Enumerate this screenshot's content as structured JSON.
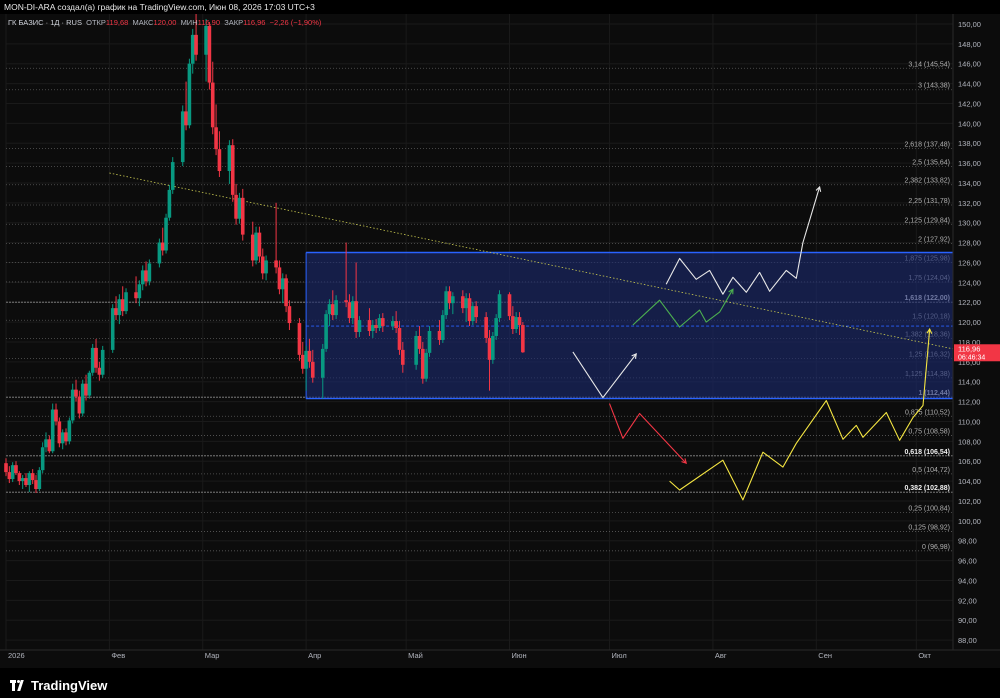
{
  "header": {
    "attribution": "MON-DI-ARA создал(а) график на TradingView.com, Июн 08, 2026 17:03 UTC+3"
  },
  "legend": {
    "symbol": "ГК БАЗИС · 1Д · RUS",
    "open_label": "ОТКР",
    "open": "119,68",
    "high_label": "МАКС",
    "high": "120,00",
    "low_label": "МИН",
    "low": "116,90",
    "close_label": "ЗАКР",
    "close": "116,96",
    "change": "−2,26 (−1,90%)"
  },
  "price_badge": {
    "price": "116,96",
    "countdown": "06:46:34",
    "color": "#f23645"
  },
  "brand": {
    "name": "TradingView"
  },
  "colors": {
    "up": "#089981",
    "down": "#f23645",
    "box_fill": "#1c2a6e",
    "box_border": "#2962ff",
    "path_white": "#e8e8e8",
    "path_green": "#4caf50",
    "path_red": "#f23645",
    "path_yellow": "#f5e642",
    "trendline": "#c8c850"
  },
  "chart_data": {
    "type": "candlestick",
    "y_axis": {
      "range": [
        87,
        151
      ],
      "ticks": [
        "150,00",
        "148,00",
        "146,00",
        "144,00",
        "142,00",
        "140,00",
        "138,00",
        "136,00",
        "134,00",
        "132,00",
        "130,00",
        "128,00",
        "126,00",
        "124,00",
        "122,00",
        "120,00",
        "118,00",
        "116,00",
        "114,00",
        "112,00",
        "110,00",
        "108,00",
        "106,00",
        "104,00",
        "102,00",
        "100,00",
        "98,00",
        "96,00",
        "94,00",
        "92,00",
        "90,00",
        "88,00"
      ]
    },
    "x_axis": {
      "range": [
        "2026-01-01",
        "2026-10-12"
      ],
      "ticks": [
        {
          "date": "2026-01-01",
          "label": "2026"
        },
        {
          "date": "2026-02-01",
          "label": "Фев"
        },
        {
          "date": "2026-03-01",
          "label": "Мар"
        },
        {
          "date": "2026-04-01",
          "label": "Апр"
        },
        {
          "date": "2026-05-01",
          "label": "Май"
        },
        {
          "date": "2026-06-01",
          "label": "Июн"
        },
        {
          "date": "2026-07-01",
          "label": "Июл"
        },
        {
          "date": "2026-08-01",
          "label": "Авг"
        },
        {
          "date": "2026-09-01",
          "label": "Сен"
        },
        {
          "date": "2026-10-01",
          "label": "Окт"
        }
      ]
    },
    "candles_ohlc": [
      [
        "2026-01-01",
        105.8,
        106.3,
        104.5,
        104.9
      ],
      [
        "2026-01-02",
        104.9,
        105.5,
        103.8,
        104.2
      ],
      [
        "2026-01-03",
        104.2,
        105.9,
        103.9,
        105.6
      ],
      [
        "2026-01-04",
        105.6,
        106.0,
        104.6,
        104.8
      ],
      [
        "2026-01-05",
        104.8,
        105.0,
        103.6,
        104.0
      ],
      [
        "2026-01-06",
        104.0,
        104.6,
        103.2,
        104.3
      ],
      [
        "2026-01-07",
        104.3,
        104.8,
        103.4,
        103.6
      ],
      [
        "2026-01-08",
        103.6,
        105.0,
        102.9,
        104.8
      ],
      [
        "2026-01-09",
        104.8,
        105.2,
        103.7,
        104.1
      ],
      [
        "2026-01-10",
        104.1,
        104.6,
        102.8,
        103.2
      ],
      [
        "2026-01-11",
        103.2,
        105.4,
        103.0,
        105.1
      ],
      [
        "2026-01-12",
        105.1,
        107.9,
        104.8,
        107.4
      ],
      [
        "2026-01-13",
        107.4,
        108.9,
        106.9,
        108.2
      ],
      [
        "2026-01-14",
        108.2,
        108.6,
        106.8,
        107.0
      ],
      [
        "2026-01-15",
        107.0,
        111.8,
        106.8,
        111.2
      ],
      [
        "2026-01-16",
        111.2,
        111.8,
        109.6,
        110.0
      ],
      [
        "2026-01-17",
        110.0,
        110.4,
        107.4,
        107.8
      ],
      [
        "2026-01-18",
        107.8,
        109.2,
        107.2,
        108.9
      ],
      [
        "2026-01-19",
        108.9,
        109.3,
        107.6,
        108.0
      ],
      [
        "2026-01-20",
        108.0,
        110.4,
        107.7,
        110.1
      ],
      [
        "2026-01-21",
        110.1,
        113.8,
        109.8,
        113.2
      ],
      [
        "2026-01-22",
        113.2,
        114.2,
        112.0,
        112.5
      ],
      [
        "2026-01-23",
        112.5,
        113.1,
        110.3,
        110.8
      ],
      [
        "2026-01-24",
        110.8,
        114.2,
        110.5,
        113.8
      ],
      [
        "2026-01-25",
        113.8,
        114.7,
        112.1,
        112.6
      ],
      [
        "2026-01-26",
        112.6,
        115.1,
        112.3,
        114.9
      ],
      [
        "2026-01-27",
        114.9,
        117.8,
        114.6,
        117.4
      ],
      [
        "2026-01-28",
        117.4,
        118.3,
        114.9,
        115.4
      ],
      [
        "2026-01-29",
        115.4,
        116.0,
        114.1,
        114.7
      ],
      [
        "2026-01-30",
        114.7,
        117.6,
        114.4,
        117.2
      ],
      [
        "2026-02-02",
        117.2,
        121.8,
        116.9,
        121.4
      ],
      [
        "2026-02-03",
        121.4,
        122.6,
        120.2,
        120.7
      ],
      [
        "2026-02-04",
        120.7,
        122.8,
        119.8,
        122.3
      ],
      [
        "2026-02-05",
        122.3,
        123.6,
        120.6,
        121.1
      ],
      [
        "2026-02-06",
        121.1,
        123.4,
        120.8,
        123.0
      ],
      [
        "2026-02-09",
        123.0,
        124.6,
        121.9,
        122.4
      ],
      [
        "2026-02-10",
        122.4,
        124.2,
        121.6,
        123.8
      ],
      [
        "2026-02-11",
        123.8,
        125.7,
        123.2,
        125.2
      ],
      [
        "2026-02-12",
        125.2,
        126.1,
        123.6,
        124.1
      ],
      [
        "2026-02-13",
        124.1,
        126.3,
        123.7,
        125.9
      ],
      [
        "2026-02-16",
        125.9,
        128.4,
        125.5,
        128.0
      ],
      [
        "2026-02-17",
        128.0,
        129.5,
        126.7,
        127.2
      ],
      [
        "2026-02-18",
        127.2,
        130.9,
        126.9,
        130.5
      ],
      [
        "2026-02-19",
        130.5,
        133.8,
        130.2,
        133.3
      ],
      [
        "2026-02-20",
        133.3,
        136.6,
        132.9,
        136.1
      ],
      [
        "2026-02-23",
        136.1,
        141.8,
        135.7,
        141.2
      ],
      [
        "2026-02-24",
        141.2,
        144.2,
        139.3,
        139.8
      ],
      [
        "2026-02-25",
        139.8,
        146.5,
        139.5,
        146.0
      ],
      [
        "2026-02-26",
        146.0,
        149.5,
        145.0,
        148.9
      ],
      [
        "2026-02-27",
        148.9,
        151.0,
        146.3,
        146.9
      ],
      [
        "2026-03-02",
        146.9,
        150.5,
        144.2,
        149.8
      ],
      [
        "2026-03-03",
        149.8,
        150.2,
        143.4,
        144.1
      ],
      [
        "2026-03-04",
        144.1,
        146.2,
        138.9,
        139.6
      ],
      [
        "2026-03-05",
        139.6,
        141.9,
        136.8,
        137.4
      ],
      [
        "2026-03-06",
        137.4,
        139.2,
        134.6,
        135.2
      ],
      [
        "2026-03-09",
        135.2,
        138.3,
        133.9,
        137.8
      ],
      [
        "2026-03-10",
        137.8,
        138.4,
        132.1,
        132.8
      ],
      [
        "2026-03-11",
        132.8,
        133.9,
        129.8,
        130.4
      ],
      [
        "2026-03-12",
        130.4,
        133.0,
        129.9,
        132.5
      ],
      [
        "2026-03-13",
        132.5,
        133.4,
        128.2,
        128.8
      ],
      [
        "2026-03-16",
        128.8,
        130.1,
        125.6,
        126.2
      ],
      [
        "2026-03-17",
        126.2,
        129.6,
        125.8,
        129.0
      ],
      [
        "2026-03-18",
        129.0,
        129.6,
        126.0,
        126.6
      ],
      [
        "2026-03-19",
        126.6,
        127.4,
        124.3,
        124.9
      ],
      [
        "2026-03-20",
        124.9,
        126.7,
        124.2,
        126.2
      ],
      [
        "2026-03-23",
        126.2,
        132.0,
        124.9,
        125.5
      ],
      [
        "2026-03-24",
        125.5,
        126.2,
        122.8,
        123.3
      ],
      [
        "2026-03-25",
        123.3,
        124.9,
        121.9,
        124.4
      ],
      [
        "2026-03-26",
        124.4,
        124.8,
        121.0,
        121.6
      ],
      [
        "2026-03-27",
        121.6,
        122.2,
        119.2,
        119.9
      ],
      [
        "2026-03-30",
        119.9,
        120.4,
        116.1,
        116.7
      ],
      [
        "2026-03-31",
        116.7,
        118.0,
        114.8,
        115.3
      ],
      [
        "2026-04-01",
        115.3,
        117.6,
        113.1,
        117.1
      ],
      [
        "2026-04-02",
        117.1,
        118.3,
        115.4,
        116.0
      ],
      [
        "2026-04-03",
        116.0,
        117.2,
        113.9,
        114.4
      ],
      [
        "2026-04-06",
        114.4,
        117.8,
        112.3,
        117.3
      ],
      [
        "2026-04-07",
        117.3,
        121.2,
        117.0,
        120.8
      ],
      [
        "2026-04-08",
        120.8,
        122.3,
        119.6,
        121.8
      ],
      [
        "2026-04-09",
        121.8,
        123.2,
        120.2,
        120.7
      ],
      [
        "2026-04-10",
        120.7,
        122.7,
        120.3,
        122.2
      ],
      [
        "2026-04-13",
        122.2,
        128.0,
        121.5,
        122.0
      ],
      [
        "2026-04-14",
        122.0,
        122.8,
        119.9,
        120.4
      ],
      [
        "2026-04-15",
        120.4,
        122.6,
        119.8,
        122.1
      ],
      [
        "2026-04-16",
        122.1,
        126.0,
        118.4,
        119.0
      ],
      [
        "2026-04-17",
        119.0,
        120.6,
        118.5,
        120.2
      ],
      [
        "2026-04-20",
        120.2,
        121.4,
        118.6,
        119.1
      ],
      [
        "2026-04-21",
        119.1,
        120.2,
        118.4,
        119.7
      ],
      [
        "2026-04-22",
        119.7,
        120.3,
        118.9,
        119.4
      ],
      [
        "2026-04-23",
        119.4,
        120.8,
        119.1,
        120.4
      ],
      [
        "2026-04-24",
        120.4,
        120.9,
        119.0,
        119.6
      ],
      [
        "2026-04-27",
        119.6,
        120.6,
        119.2,
        120.1
      ],
      [
        "2026-04-28",
        120.1,
        121.1,
        118.9,
        119.4
      ],
      [
        "2026-04-29",
        119.4,
        120.1,
        116.7,
        117.2
      ],
      [
        "2026-04-30",
        117.2,
        118.0,
        114.9,
        115.7
      ],
      [
        "2026-05-04",
        115.7,
        119.1,
        115.2,
        118.6
      ],
      [
        "2026-05-05",
        118.6,
        119.6,
        116.8,
        117.3
      ],
      [
        "2026-05-06",
        117.3,
        118.0,
        113.8,
        114.3
      ],
      [
        "2026-05-07",
        114.3,
        117.3,
        114.0,
        116.9
      ],
      [
        "2026-05-08",
        116.9,
        119.6,
        116.5,
        119.1
      ],
      [
        "2026-05-11",
        119.1,
        120.2,
        117.7,
        118.2
      ],
      [
        "2026-05-12",
        118.2,
        121.2,
        117.9,
        120.7
      ],
      [
        "2026-05-13",
        120.7,
        123.6,
        120.3,
        123.1
      ],
      [
        "2026-05-14",
        123.1,
        123.6,
        121.3,
        121.9
      ],
      [
        "2026-05-15",
        121.9,
        123.0,
        120.8,
        122.6
      ],
      [
        "2026-05-18",
        122.6,
        123.2,
        120.9,
        121.4
      ],
      [
        "2026-05-19",
        121.4,
        122.9,
        120.0,
        122.4
      ],
      [
        "2026-05-20",
        122.4,
        122.9,
        119.6,
        120.1
      ],
      [
        "2026-05-21",
        120.1,
        122.0,
        119.7,
        121.6
      ],
      [
        "2026-05-22",
        121.6,
        122.1,
        119.9,
        120.5
      ],
      [
        "2026-05-25",
        120.5,
        121.0,
        117.9,
        118.4
      ],
      [
        "2026-05-26",
        118.4,
        119.2,
        113.1,
        116.2
      ],
      [
        "2026-05-27",
        116.2,
        119.0,
        115.8,
        118.6
      ],
      [
        "2026-05-28",
        118.6,
        120.8,
        118.2,
        120.4
      ],
      [
        "2026-05-29",
        120.4,
        123.2,
        120.0,
        122.8
      ],
      [
        "2026-06-01",
        122.8,
        123.0,
        120.2,
        120.6
      ],
      [
        "2026-06-02",
        120.6,
        121.6,
        118.8,
        119.3
      ],
      [
        "2026-06-03",
        119.3,
        121.0,
        118.9,
        120.5
      ],
      [
        "2026-06-04",
        120.5,
        121.0,
        118.7,
        119.7
      ],
      [
        "2026-06-05",
        119.7,
        120.0,
        116.9,
        116.96
      ]
    ],
    "fib_levels": [
      {
        "ratio": "3,14",
        "price": "145,54",
        "bold": false
      },
      {
        "ratio": "3",
        "price": "143,38",
        "bold": false
      },
      {
        "ratio": "2,618",
        "price": "137,48",
        "bold": false
      },
      {
        "ratio": "2,5",
        "price": "135,64",
        "bold": false
      },
      {
        "ratio": "2,382",
        "price": "133,82",
        "bold": false
      },
      {
        "ratio": "2,25",
        "price": "131,78",
        "bold": false
      },
      {
        "ratio": "2,125",
        "price": "129,84",
        "bold": false
      },
      {
        "ratio": "2",
        "price": "127,92",
        "bold": false
      },
      {
        "ratio": "1,875",
        "price": "125,98",
        "bold": false
      },
      {
        "ratio": "1,75",
        "price": "124,04",
        "bold": false
      },
      {
        "ratio": "1,618",
        "price": "122,00",
        "bold": true
      },
      {
        "ratio": "1,5",
        "price": "120,18",
        "bold": false
      },
      {
        "ratio": "1,382",
        "price": "118,36",
        "bold": false
      },
      {
        "ratio": "1,25",
        "price": "116,32",
        "bold": false
      },
      {
        "ratio": "1,125",
        "price": "114,38",
        "bold": false
      },
      {
        "ratio": "1",
        "price": "112,44",
        "bold": true
      },
      {
        "ratio": "0,875",
        "price": "110,52",
        "bold": false
      },
      {
        "ratio": "0,75",
        "price": "108,58",
        "bold": false
      },
      {
        "ratio": "0,618",
        "price": "106,54",
        "bold": true
      },
      {
        "ratio": "0,5",
        "price": "104,72",
        "bold": false
      },
      {
        "ratio": "0,382",
        "price": "102,88",
        "bold": true
      },
      {
        "ratio": "0,25",
        "price": "100,84",
        "bold": false
      },
      {
        "ratio": "0,125",
        "price": "98,92",
        "bold": false
      },
      {
        "ratio": "0",
        "price": "96,98",
        "bold": false
      }
    ],
    "range_box": {
      "from": "2026-04-01",
      "to": "2026-10-12",
      "top": 127.0,
      "bottom": 112.3,
      "mid": 119.6
    },
    "trendline": [
      [
        "2026-02-01",
        135.0
      ],
      [
        "2026-10-12",
        117.3
      ]
    ],
    "projection_paths": {
      "white_bounce": [
        [
          "2026-06-20",
          117.0
        ],
        [
          "2026-06-29",
          112.4
        ],
        [
          "2026-07-09",
          116.8
        ]
      ],
      "green_up": [
        [
          "2026-07-08",
          119.7
        ],
        [
          "2026-07-16",
          122.2
        ],
        [
          "2026-07-22",
          119.5
        ],
        [
          "2026-07-28",
          121.2
        ],
        [
          "2026-07-30",
          120.0
        ],
        [
          "2026-08-03",
          121.0
        ],
        [
          "2026-08-07",
          123.3
        ]
      ],
      "white_up": [
        [
          "2026-07-18",
          123.8
        ],
        [
          "2026-07-22",
          126.4
        ],
        [
          "2026-07-27",
          124.3
        ],
        [
          "2026-07-31",
          125.2
        ],
        [
          "2026-08-04",
          122.8
        ],
        [
          "2026-08-07",
          124.5
        ],
        [
          "2026-08-11",
          123.0
        ],
        [
          "2026-08-15",
          125.0
        ],
        [
          "2026-08-18",
          123.1
        ],
        [
          "2026-08-23",
          125.2
        ],
        [
          "2026-08-26",
          124.4
        ],
        [
          "2026-08-28",
          128.0
        ],
        [
          "2026-09-02",
          133.6
        ]
      ],
      "red_down": [
        [
          "2026-07-01",
          111.8
        ],
        [
          "2026-07-05",
          108.3
        ],
        [
          "2026-07-10",
          110.8
        ],
        [
          "2026-07-24",
          105.8
        ]
      ],
      "yellow_up": [
        [
          "2026-07-19",
          104.0
        ],
        [
          "2026-07-22",
          103.1
        ],
        [
          "2026-08-04",
          106.1
        ],
        [
          "2026-08-10",
          102.1
        ],
        [
          "2026-08-16",
          106.9
        ],
        [
          "2026-08-22",
          105.4
        ],
        [
          "2026-08-26",
          107.8
        ],
        [
          "2026-09-04",
          112.1
        ],
        [
          "2026-09-09",
          108.2
        ],
        [
          "2026-09-13",
          109.6
        ],
        [
          "2026-09-15",
          108.4
        ],
        [
          "2026-09-22",
          110.9
        ],
        [
          "2026-09-26",
          108.1
        ],
        [
          "2026-09-30",
          110.4
        ],
        [
          "2026-10-03",
          111.6
        ],
        [
          "2026-10-05",
          119.3
        ]
      ]
    }
  }
}
